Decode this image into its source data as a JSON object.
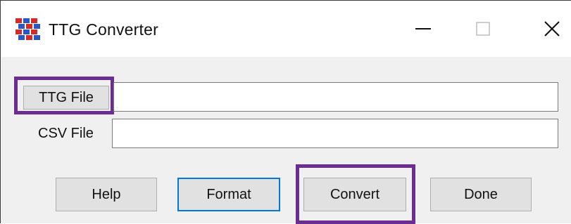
{
  "window": {
    "title": "TTG Converter",
    "controls": {
      "minimize_icon": "minimize-icon",
      "maximize_icon": "maximize-icon",
      "close_icon": "close-icon"
    }
  },
  "form": {
    "ttg_button_label": "TTG File",
    "ttg_path_value": "",
    "csv_label": "CSV File",
    "csv_path_value": ""
  },
  "buttons": {
    "help": "Help",
    "format": "Format",
    "convert": "Convert",
    "done": "Done"
  },
  "colors": {
    "highlight": "#6b2d91",
    "focus": "#0078d7",
    "dialog_bg": "#f0f0f0"
  }
}
